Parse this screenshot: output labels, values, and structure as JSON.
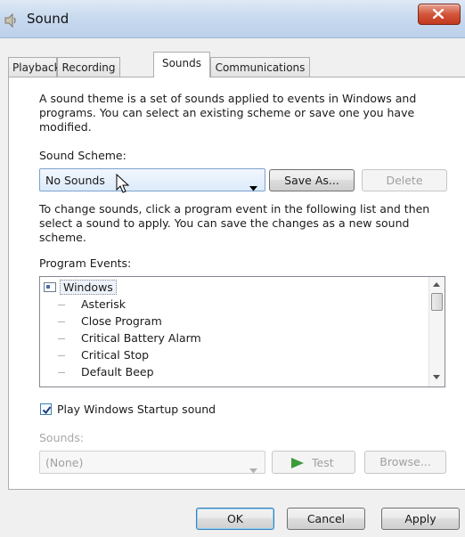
{
  "window": {
    "title": "Sound"
  },
  "tabs": [
    {
      "label": "Playback"
    },
    {
      "label": "Recording"
    },
    {
      "label": "Sounds"
    },
    {
      "label": "Communications"
    }
  ],
  "sounds_tab": {
    "description": "A sound theme is a set of sounds applied to events in Windows and programs.  You can select an existing scheme or save one you have modified.",
    "scheme_label": "Sound Scheme:",
    "scheme_value": "No Sounds",
    "save_as_label": "Save As...",
    "delete_label": "Delete",
    "instructions": "To change sounds, click a program event in the following list and then select a sound to apply.  You can save the changes as a new sound scheme.",
    "events_label": "Program Events:",
    "events_root": "Windows",
    "events": [
      "Asterisk",
      "Close Program",
      "Critical Battery Alarm",
      "Critical Stop",
      "Default Beep"
    ],
    "startup_label": "Play Windows Startup sound",
    "startup_checked": true,
    "sounds_label": "Sounds:",
    "sounds_value": "(None)",
    "test_label": "Test",
    "browse_label": "Browse..."
  },
  "footer": {
    "ok": "OK",
    "cancel": "Cancel",
    "apply": "Apply"
  },
  "icons": {
    "app": "speaker-icon",
    "close": "close-icon",
    "dropdown": "chevron-down-icon",
    "play": "play-icon"
  }
}
